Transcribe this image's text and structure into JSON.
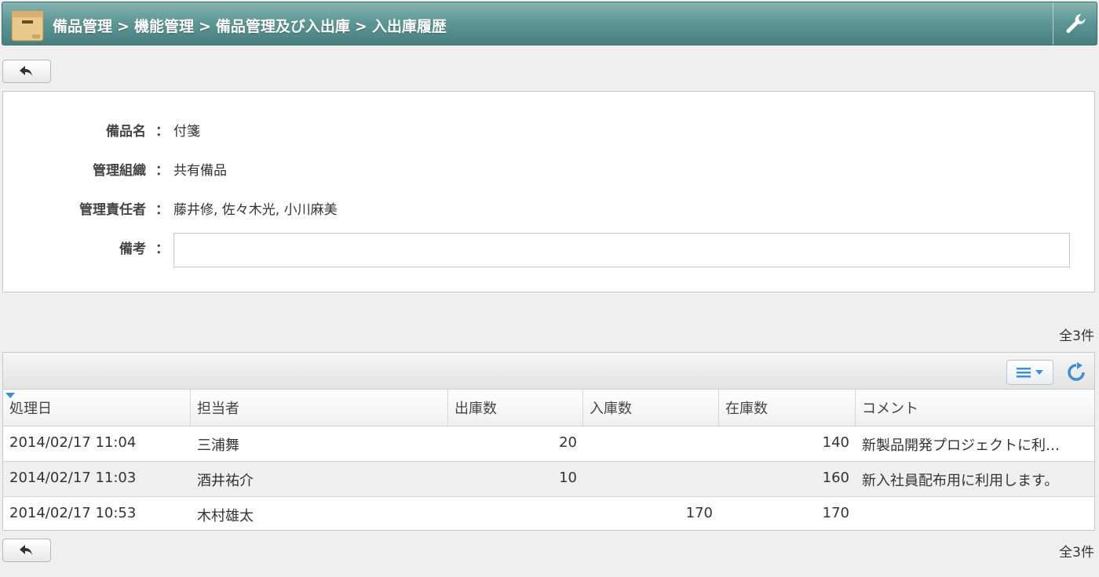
{
  "header": {
    "breadcrumb": [
      "備品管理",
      "機能管理",
      "備品管理及び入出庫",
      "入出庫履歴"
    ],
    "separator": ">",
    "app_icon": "box-icon",
    "tool_icon": "wrench-icon",
    "accent_color": "#5e9896"
  },
  "toolbar": {
    "back_icon": "back-arrow-icon"
  },
  "info": {
    "name_label": "備品名",
    "name_value": "付箋",
    "org_label": "管理組織",
    "org_value": "共有備品",
    "manager_label": "管理責任者",
    "manager_value": "藤井修, 佐々木光, 小川麻美",
    "remark_label": "備考",
    "remark_value": "",
    "colon": "："
  },
  "list": {
    "count_text": "全3件",
    "menu_icon": "list-menu-icon",
    "refresh_icon": "refresh-icon",
    "columns": [
      "処理日",
      "担当者",
      "出庫数",
      "入庫数",
      "在庫数",
      "コメント"
    ],
    "sort_column": "処理日",
    "rows": [
      {
        "date": "2014/02/17 11:04",
        "person": "三浦舞",
        "out": "20",
        "in": "",
        "stock": "140",
        "comment": "新製品開発プロジェクトに利…"
      },
      {
        "date": "2014/02/17 11:03",
        "person": "酒井祐介",
        "out": "10",
        "in": "",
        "stock": "160",
        "comment": "新入社員配布用に利用します。"
      },
      {
        "date": "2014/02/17 10:53",
        "person": "木村雄太",
        "out": "",
        "in": "170",
        "stock": "170",
        "comment": ""
      }
    ]
  }
}
